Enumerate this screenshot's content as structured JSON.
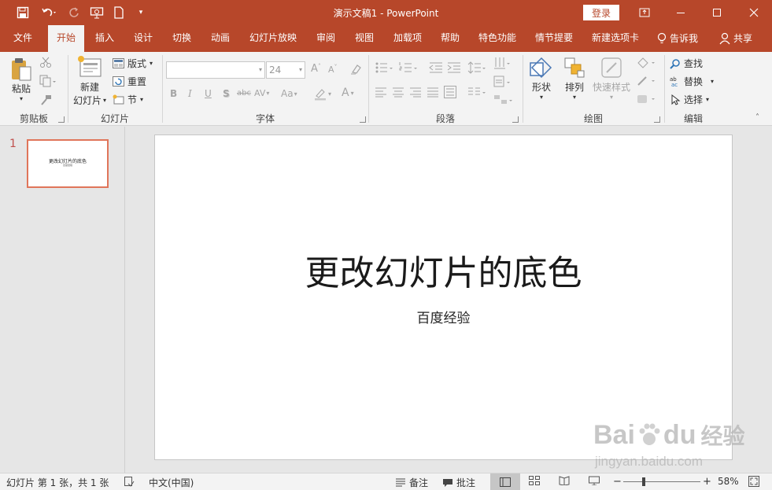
{
  "window": {
    "title": "演示文稿1  -  PowerPoint",
    "login_label": "登录"
  },
  "tabs": [
    {
      "label": "文件"
    },
    {
      "label": "开始"
    },
    {
      "label": "插入"
    },
    {
      "label": "设计"
    },
    {
      "label": "切换"
    },
    {
      "label": "动画"
    },
    {
      "label": "幻灯片放映"
    },
    {
      "label": "审阅"
    },
    {
      "label": "视图"
    },
    {
      "label": "加载项"
    },
    {
      "label": "帮助"
    },
    {
      "label": "特色功能"
    },
    {
      "label": "情节提要"
    },
    {
      "label": "新建选项卡"
    },
    {
      "label": "告诉我"
    },
    {
      "label": "共享"
    }
  ],
  "ribbon": {
    "clipboard": {
      "paste": "粘贴",
      "group": "剪贴板"
    },
    "slides": {
      "new_slide_line1": "新建",
      "new_slide_line2": "幻灯片",
      "layout": "版式",
      "reset": "重置",
      "section": "节",
      "group": "幻灯片"
    },
    "font": {
      "font_name": "",
      "font_size": "24",
      "bold": "B",
      "italic": "I",
      "underline": "U",
      "shadow": "S",
      "strike": "abc",
      "spacing": "AV",
      "case": "Aa",
      "grow": "A",
      "shrink": "A",
      "color": "A",
      "group": "字体"
    },
    "paragraph": {
      "group": "段落"
    },
    "drawing": {
      "shapes": "形状",
      "arrange": "排列",
      "quick_styles": "快速样式",
      "group": "绘图"
    },
    "editing": {
      "find": "查找",
      "replace": "替换",
      "select": "选择",
      "group": "编辑"
    }
  },
  "thumbnail": {
    "number": "1",
    "title": "更改幻灯片的底色",
    "subtitle": "百度经验"
  },
  "slide": {
    "title": "更改幻灯片的底色",
    "subtitle": "百度经验"
  },
  "status": {
    "slide_info": "幻灯片 第 1 张，共 1 张",
    "language": "中文(中国)",
    "notes": "备注",
    "comments": "批注",
    "zoom": "58%",
    "zoom_level": 0.58
  },
  "watermark": {
    "brand": "Bai",
    "brand2": "du",
    "site_cn": "经验",
    "url": "jingyan.baidu.com"
  },
  "colors": {
    "accent": "#b7472a",
    "selection": "#e0755a"
  }
}
